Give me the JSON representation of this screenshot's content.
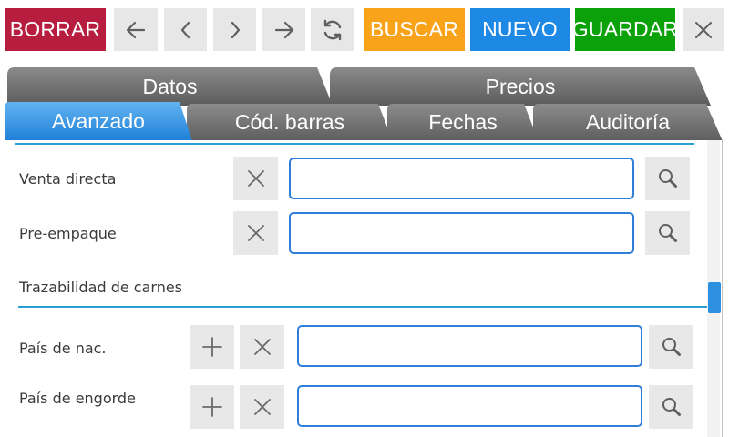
{
  "toolbar": {
    "delete_label": "BORRAR",
    "search_label": "BUSCAR",
    "new_label": "NUEVO",
    "save_label": "GUARDAR",
    "icons": [
      "arrow-left-icon",
      "chevron-left-icon",
      "chevron-right-icon",
      "arrow-right-icon",
      "refresh-icon",
      "close-icon"
    ]
  },
  "tabs": {
    "top": [
      {
        "label": "Datos"
      },
      {
        "label": "Precios"
      }
    ],
    "bottom": [
      {
        "label": "Avanzado"
      },
      {
        "label": "Cód. barras"
      },
      {
        "label": "Fechas"
      },
      {
        "label": "Auditoría"
      }
    ],
    "active": "Avanzado"
  },
  "form": {
    "rows": [
      {
        "label": "Venta directa",
        "value": ""
      },
      {
        "label": "Pre-empaque",
        "value": ""
      }
    ],
    "section_title": "Trazabilidad de carnes",
    "section_rows": [
      {
        "label": "País de nac.",
        "value": ""
      },
      {
        "label": "País de engorde",
        "value": ""
      }
    ]
  },
  "colors": {
    "delete": "#b61d3f",
    "search": "#f9a31a",
    "new": "#1e88e5",
    "save": "#0aa10a",
    "tab_inactive": "#6d6d6d",
    "tab_active": "#2d8fe0",
    "accent_line": "#2a9fd4",
    "input_border": "#2f7fd8"
  }
}
